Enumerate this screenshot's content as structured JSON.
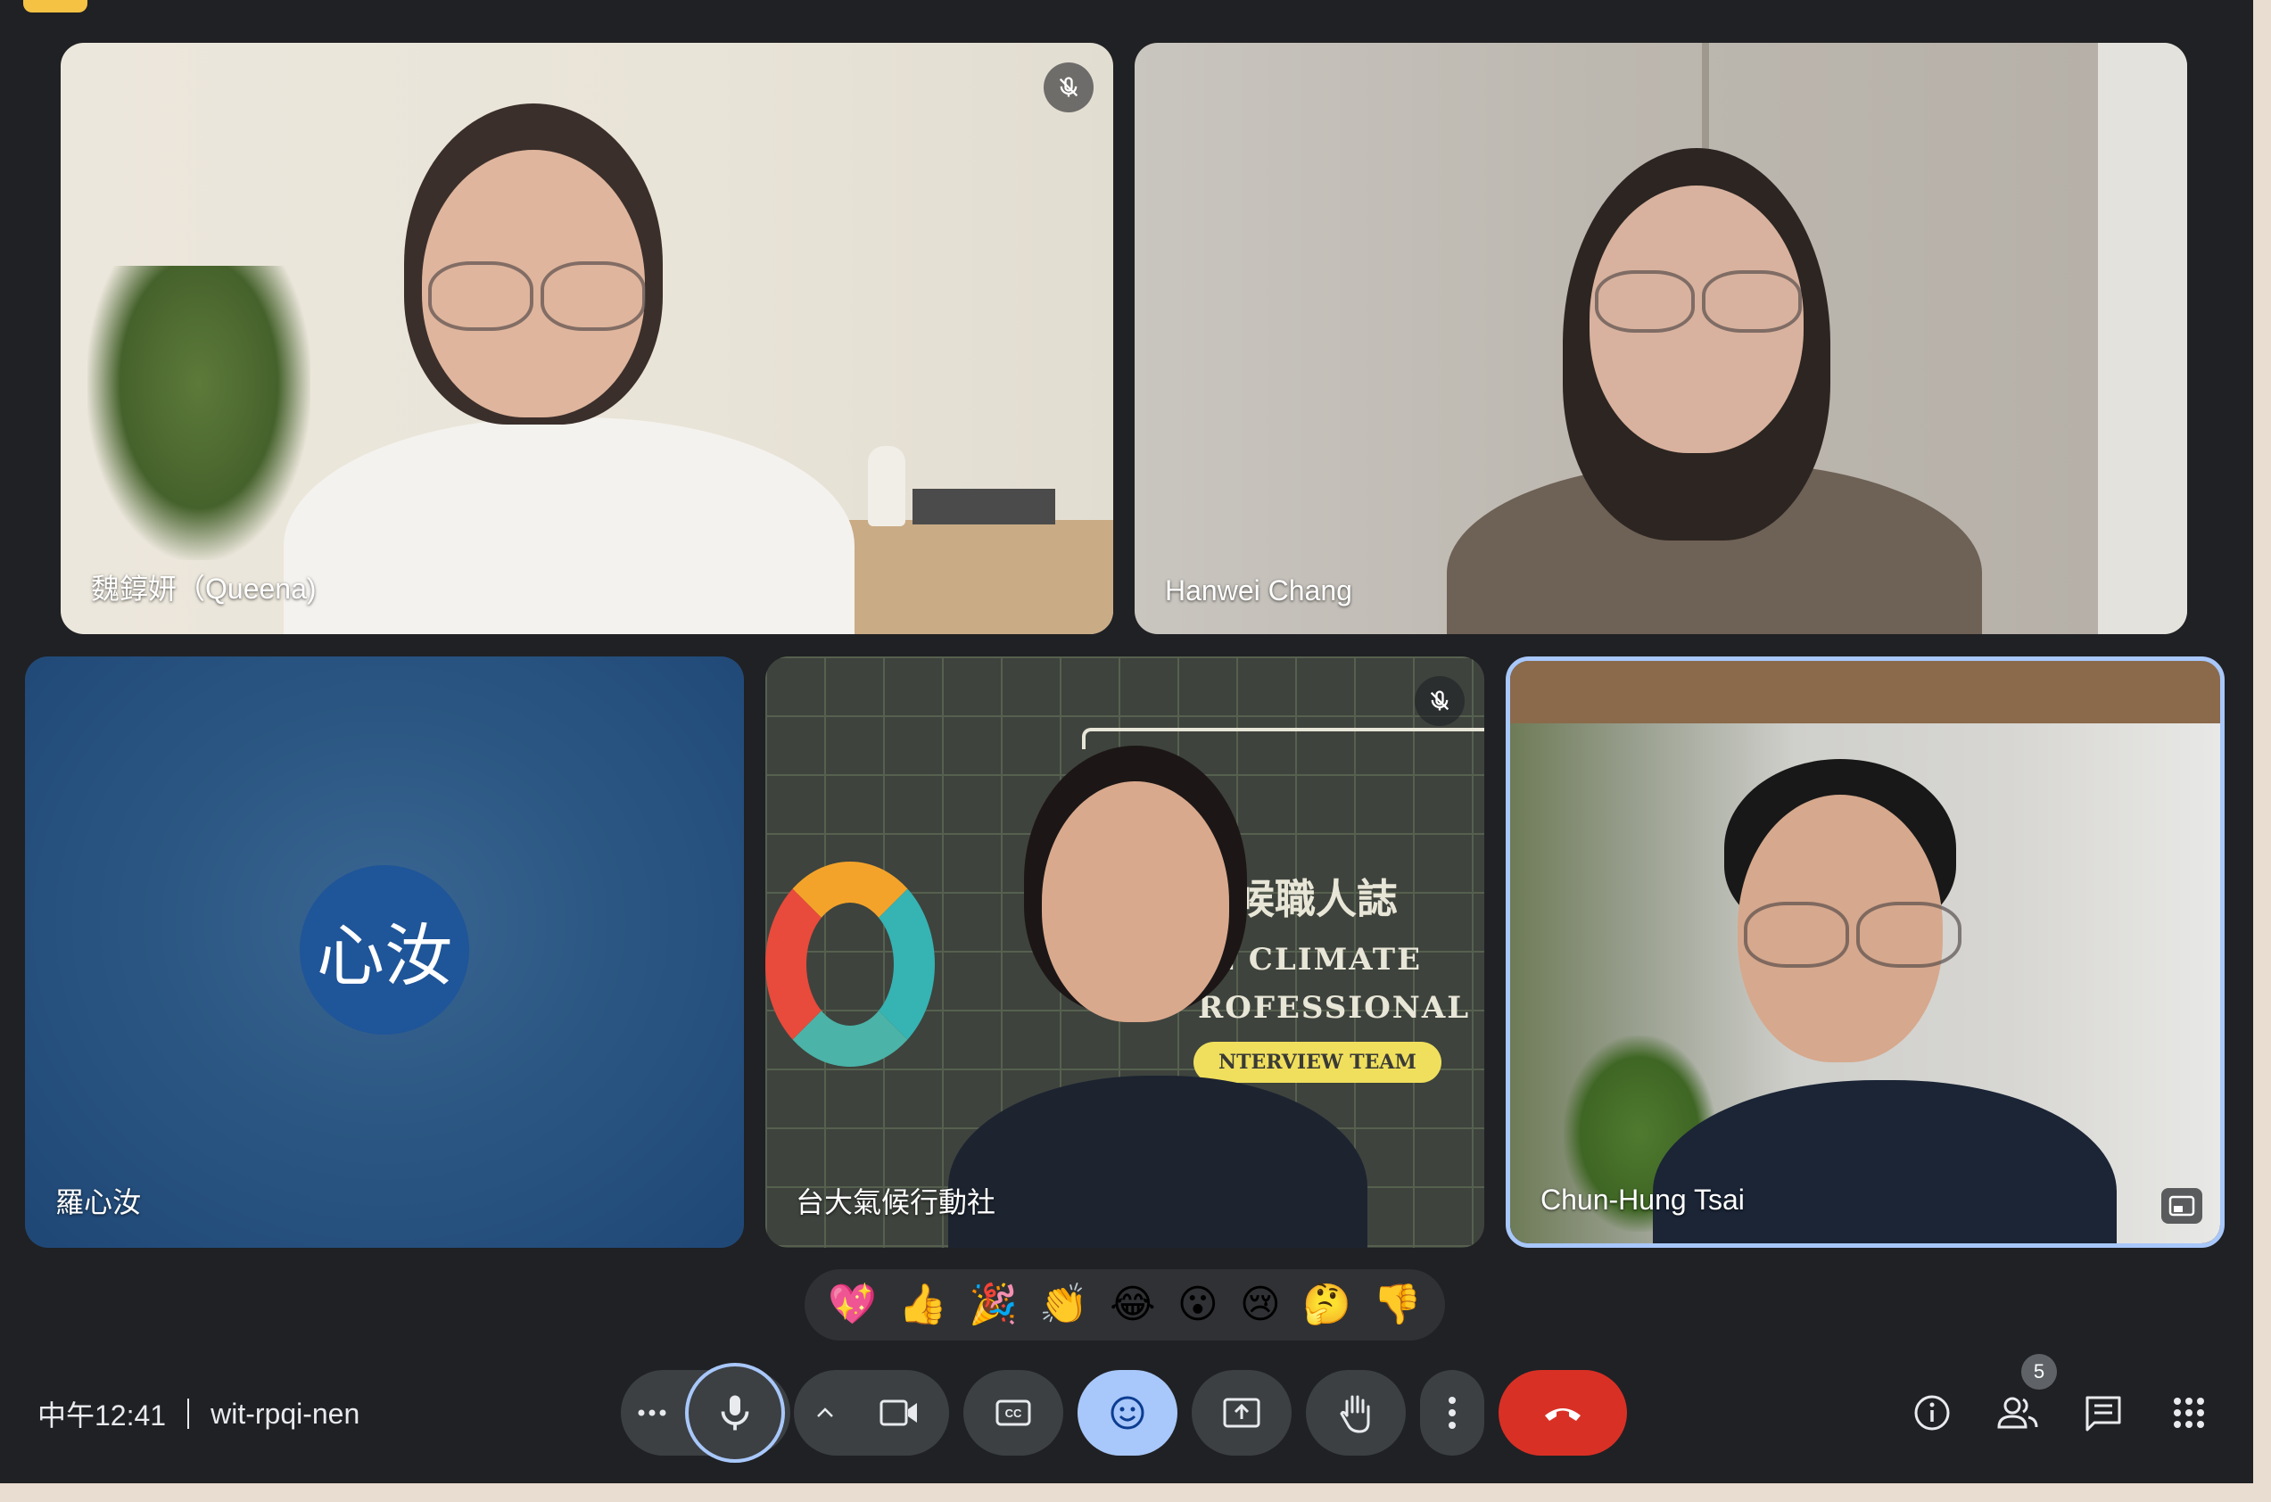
{
  "participants": [
    {
      "name": "魏錞妍（Queena)"
    },
    {
      "name": "Hanwei Chang"
    },
    {
      "name": "羅心汝",
      "avatar_initials": "心汝"
    },
    {
      "name": "台大氣候行動社"
    },
    {
      "name": "Chun-Hung Tsai"
    }
  ],
  "slide": {
    "line1": "候職人誌",
    "line2": "E CLIMATE",
    "line3": "ROFESSIONAL S",
    "line4": "NTERVIEW TEAM"
  },
  "reactions": [
    "💖",
    "👍",
    "🎉",
    "👏",
    "😂",
    "😮",
    "😢",
    "🤔",
    "👎"
  ],
  "meeting": {
    "time": "中午12:41",
    "code": "wit-rpqi-nen"
  },
  "participant_count": "5",
  "colors": {
    "end_call": "#d93025",
    "emoji_active": "#a8c7fa",
    "active_tile_border": "#a8c7fa",
    "avatar": "#1f5599"
  }
}
